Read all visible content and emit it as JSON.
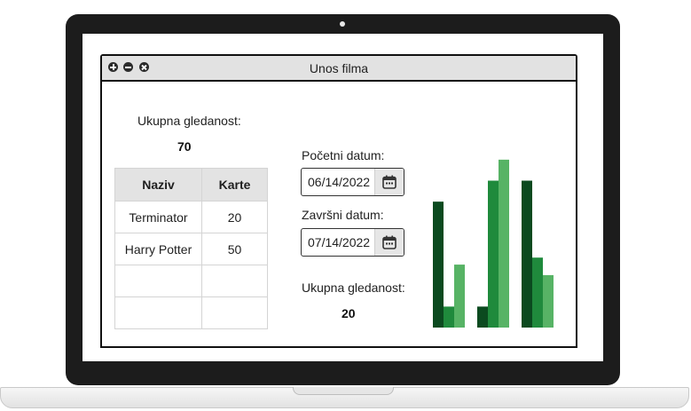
{
  "window": {
    "title": "Unos filma",
    "buttons": [
      "add-icon",
      "minimize-icon",
      "close-icon"
    ]
  },
  "total": {
    "label": "Ukupna gledanost:",
    "value": "70"
  },
  "table": {
    "headers": [
      "Naziv",
      "Karte"
    ],
    "rows": [
      [
        "Terminator",
        "20"
      ],
      [
        "Harry Potter",
        "50"
      ],
      [
        "",
        ""
      ],
      [
        "",
        ""
      ]
    ]
  },
  "filter": {
    "start_label": "Početni datum:",
    "start_value": "06/14/2022",
    "end_label": "Završni datum:",
    "end_value": "07/14/2022",
    "calendar_icon": "calendar-icon"
  },
  "filtered_total": {
    "label": "Ukupna gledanost:",
    "value": "20"
  },
  "colors": {
    "dark_green": "#0b4a1f",
    "mid_green": "#1f8a3c",
    "light_green": "#57b365"
  },
  "chart_data": {
    "type": "bar",
    "categories": [
      "",
      "",
      ""
    ],
    "ylim": [
      0,
      100
    ],
    "grid": false,
    "series": [
      {
        "color": "#0b4a1f",
        "values": [
          72,
          12,
          84
        ]
      },
      {
        "color": "#1f8a3c",
        "values": [
          12,
          84,
          40
        ]
      },
      {
        "color": "#57b365",
        "values": [
          36,
          96,
          30
        ]
      }
    ]
  }
}
